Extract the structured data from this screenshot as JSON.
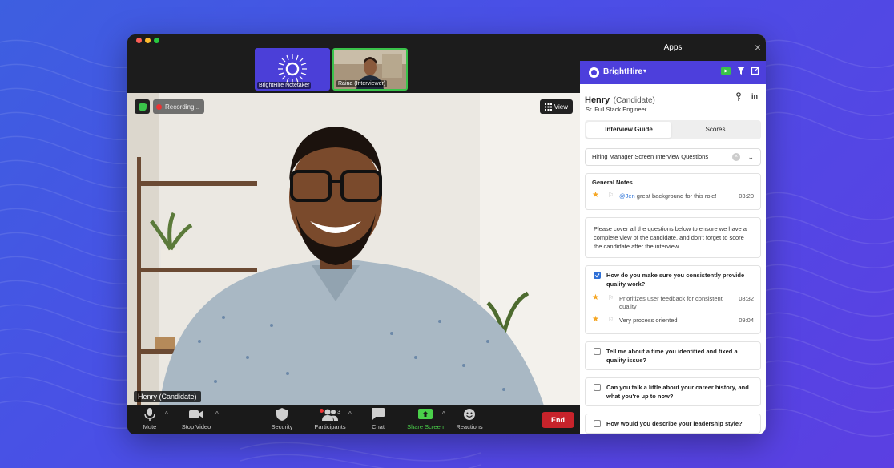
{
  "meeting": {
    "thumbnails": [
      {
        "label": "BrightHire Notetaker"
      },
      {
        "label": "Raina (Interviewer)"
      }
    ],
    "recording_label": "Recording...",
    "view_label": "View",
    "speaker_name": "Henry (Candidate)"
  },
  "toolbar": {
    "mute": "Mute",
    "stop_video": "Stop Video",
    "security": "Security",
    "participants": "Participants",
    "participants_count": "3",
    "chat": "Chat",
    "share_screen": "Share Screen",
    "reactions": "Reactions",
    "end": "End"
  },
  "apps": {
    "header_title": "Apps",
    "brand": "BrightHire",
    "candidate": {
      "name": "Henry",
      "role": "(Candidate)",
      "title": "Sr. Full Stack Engineer",
      "linkedin": "in"
    },
    "tabs": [
      {
        "label": "Interview Guide",
        "active": true
      },
      {
        "label": "Scores",
        "active": false
      }
    ],
    "guide_select": "Hiring Manager Screen Interview Questions",
    "general_notes": {
      "title": "General Notes",
      "notes": [
        {
          "mention": "@Jen",
          "text": " great background for this role!",
          "time": "03:20"
        }
      ]
    },
    "instructions": "Please cover all the questions below to ensure we have a complete view of the candidate, and don't forget to score the candidate after the interview.",
    "questions": [
      {
        "text": "How do you make sure you consistently provide quality work?",
        "checked": true,
        "notes": [
          {
            "text": "Prioritizes user feedback for consistent quality",
            "time": "08:32"
          },
          {
            "text": "Very process oriented",
            "time": "09:04"
          }
        ]
      },
      {
        "text": "Tell me about a time you identified and fixed a quality issue?",
        "checked": false
      },
      {
        "text": "Can you talk a little about your career history, and what you're up to now?",
        "checked": false
      },
      {
        "text": "How would you describe your leadership style?",
        "checked": false
      }
    ],
    "colors": {
      "brand": "#4d3fdc",
      "star": "#f5a623",
      "end": "#c8232b",
      "share": "#4ad04a"
    }
  }
}
